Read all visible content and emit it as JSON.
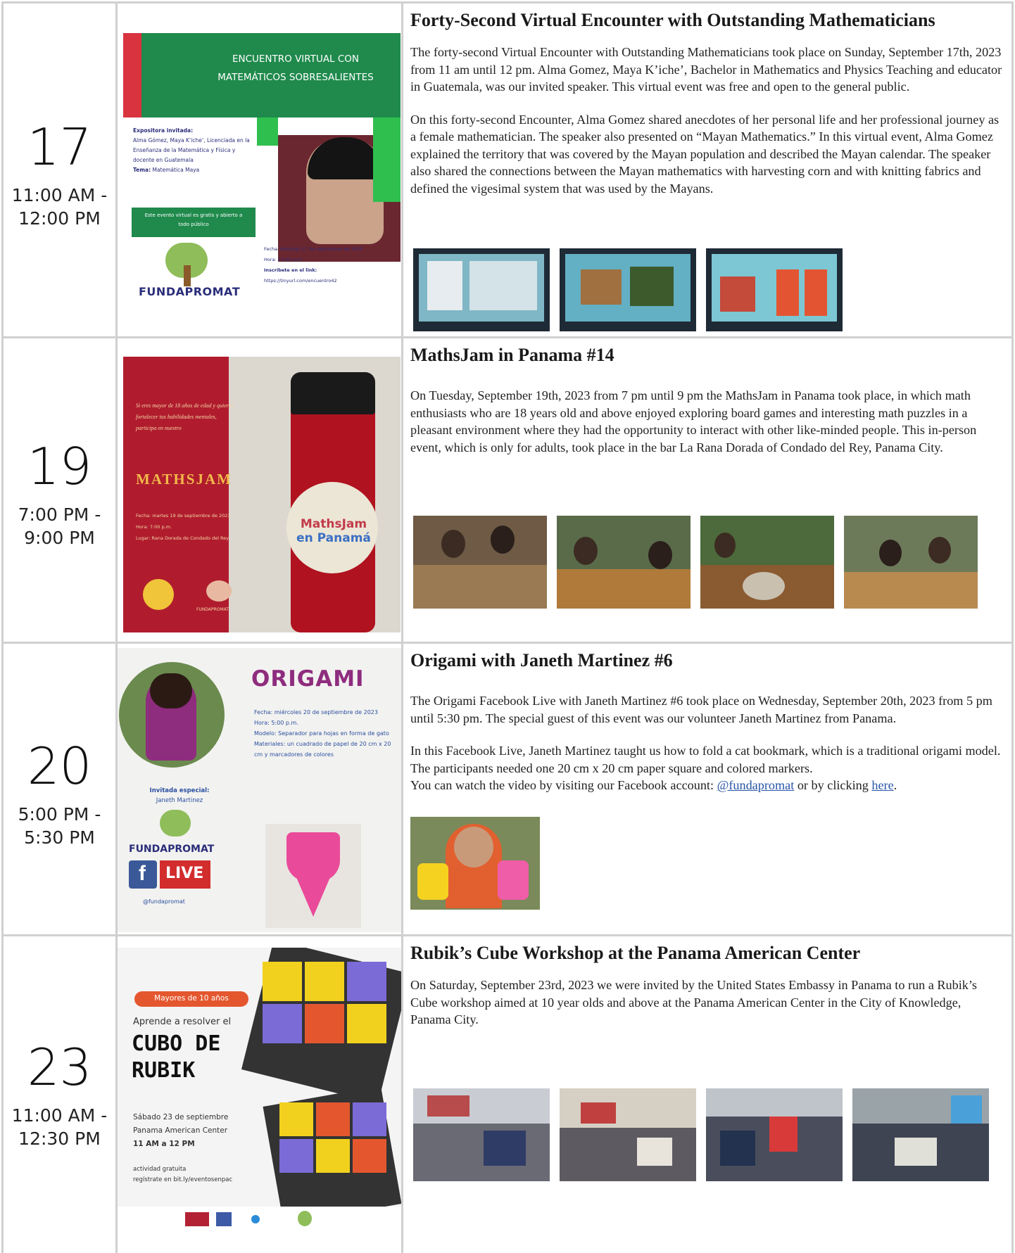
{
  "events": [
    {
      "day": "17",
      "time_start": "11:00 AM -",
      "time_end": "12:00 PM",
      "title": "Forty-Second Virtual Encounter with Outstanding Mathematicians",
      "paragraphs": [
        "The forty-second Virtual Encounter with Outstanding Mathematicians took place on Sunday, September 17th, 2023 from 11 am until 12 pm. Alma Gomez, Maya K’iche’, Bachelor in Mathematics and Physics Teaching and educator in Guatemala, was our invited speaker. This virtual event was free and open to the general public.",
        "On this forty-second Encounter, Alma Gomez shared anecdotes of her personal life and her professional journey as a female mathematician. The speaker also presented on “Mayan Mathematics.” In this virtual event, Alma Gomez explained the territory that was covered by the Mayan population and described the Mayan calendar. The speaker also shared the connections between the Mayan mathematics with harvesting corn and with knitting fabrics and defined the vigesimal system that was used by the Mayans."
      ],
      "flyer": {
        "heading_line1": "ENCUENTRO VIRTUAL CON",
        "heading_line2": "MATEMÁTICOS SOBRESALIENTES",
        "info_label": "Expositora invitada:",
        "info_text": "Alma Gómez, Maya K’iche’, Licenciada en la Enseñanza de la Matemática y Física y docente en Guatemala",
        "topic_label": "Tema:",
        "topic_text": "Matemática Maya",
        "free_text": "Este evento virtual es gratis y abierto a todo público",
        "brand": "FUNDAPROMAT",
        "date_line": "Fecha: domingo 17 de septiembre de 2023",
        "hour_line": "Hora: 11:00 a.m.",
        "link_label": "Inscríbete en el link:",
        "link_url": "https://tinyurl.com/encuentro42"
      }
    },
    {
      "day": "19",
      "time_start": "7:00 PM -",
      "time_end": "9:00 PM",
      "title": "MathsJam in Panama #14",
      "paragraphs": [
        "On Tuesday, September 19th, 2023 from 7 pm until 9 pm the MathsJam in Panama took place, in which math enthusiasts who are 18 years old and above enjoyed exploring board games and interesting math puzzles in a pleasant environment where they had the opportunity to interact with other like-minded people. This in-person event, which is only for adults, took place in the bar La Rana Dorada of Condado del Rey, Panama City."
      ],
      "flyer": {
        "intro": "Si eres mayor de 18 años de edad y quieres fortalecer tus habilidades mentales, participa en nuestro",
        "heading": "MATHSJAM",
        "date_line": "Fecha: martes 19 de septiembre de 2023",
        "hour_line": "Hora: 7:00 p.m.",
        "place_line": "Lugar: Rana Dorada de Condado del Rey",
        "badge_line1": "MathsJam",
        "badge_line2": "en Panamá",
        "brand": "FUNDAPROMAT"
      }
    },
    {
      "day": "20",
      "time_start": "5:00 PM -",
      "time_end": "5:30 PM",
      "title": "Origami with Janeth Martinez #6",
      "paragraphs": [
        "The Origami Facebook Live with Janeth Martinez #6 took place on Wednesday, September 20th, 2023 from 5 pm until 5:30 pm. The special guest of this event was our volunteer Janeth Martinez from Panama.",
        "In this Facebook Live, Janeth Martinez taught us how to fold a cat bookmark, which is a traditional origami model. The participants needed one 20 cm x 20 cm paper square and colored markers."
      ],
      "link_prefix": "You can watch the video by visiting our Facebook account: ",
      "link_account": "@fundapromat",
      "link_middle": " or by clicking ",
      "link_here": "here",
      "link_suffix": ".",
      "flyer": {
        "heading": "ORIGAMI",
        "date_line": "Fecha: miércoles 20 de septiembre de 2023",
        "hour_line": "Hora: 5:00 p.m.",
        "model_line": "Modelo: Separador para hojas en forma de gato",
        "materials_line": "Materiales: un cuadrado de papel de 20 cm x 20 cm y marcadores de colores",
        "guest_label": "Invitada especial:",
        "guest_name": "Janeth Martinez",
        "brand": "FUNDAPROMAT",
        "live": "LIVE",
        "handle": "@fundapromat"
      }
    },
    {
      "day": "23",
      "time_start": "11:00 AM -",
      "time_end": "12:30 PM",
      "title": "Rubik’s Cube Workshop at the Panama American Center",
      "paragraphs": [
        "On Saturday, September 23rd, 2023 we were invited by the United States Embassy in Panama to run a Rubik’s Cube workshop aimed at 10 year olds and above at the Panama American Center in the City of Knowledge, Panama City."
      ],
      "flyer": {
        "pill": "Mayores de 10 años",
        "line1": "Aprende a resolver el",
        "heading1": "CUBO DE",
        "heading2": "RUBIK",
        "date_line": "Sábado 23 de septiembre",
        "place_line": "Panama American Center",
        "hour_line": "11 AM a 12 PM",
        "free_line": "actividad gratuita",
        "reg_line": "regístrate en bit.ly/eventosenpac"
      }
    }
  ],
  "colors": {
    "link": "#2855a8",
    "border": "#d0d0d0",
    "flyer_green": "#1f8a4c",
    "flyer_red": "#b01c2e",
    "origami_purple": "#8e2c7e",
    "rubik_orange": "#e4572e"
  }
}
